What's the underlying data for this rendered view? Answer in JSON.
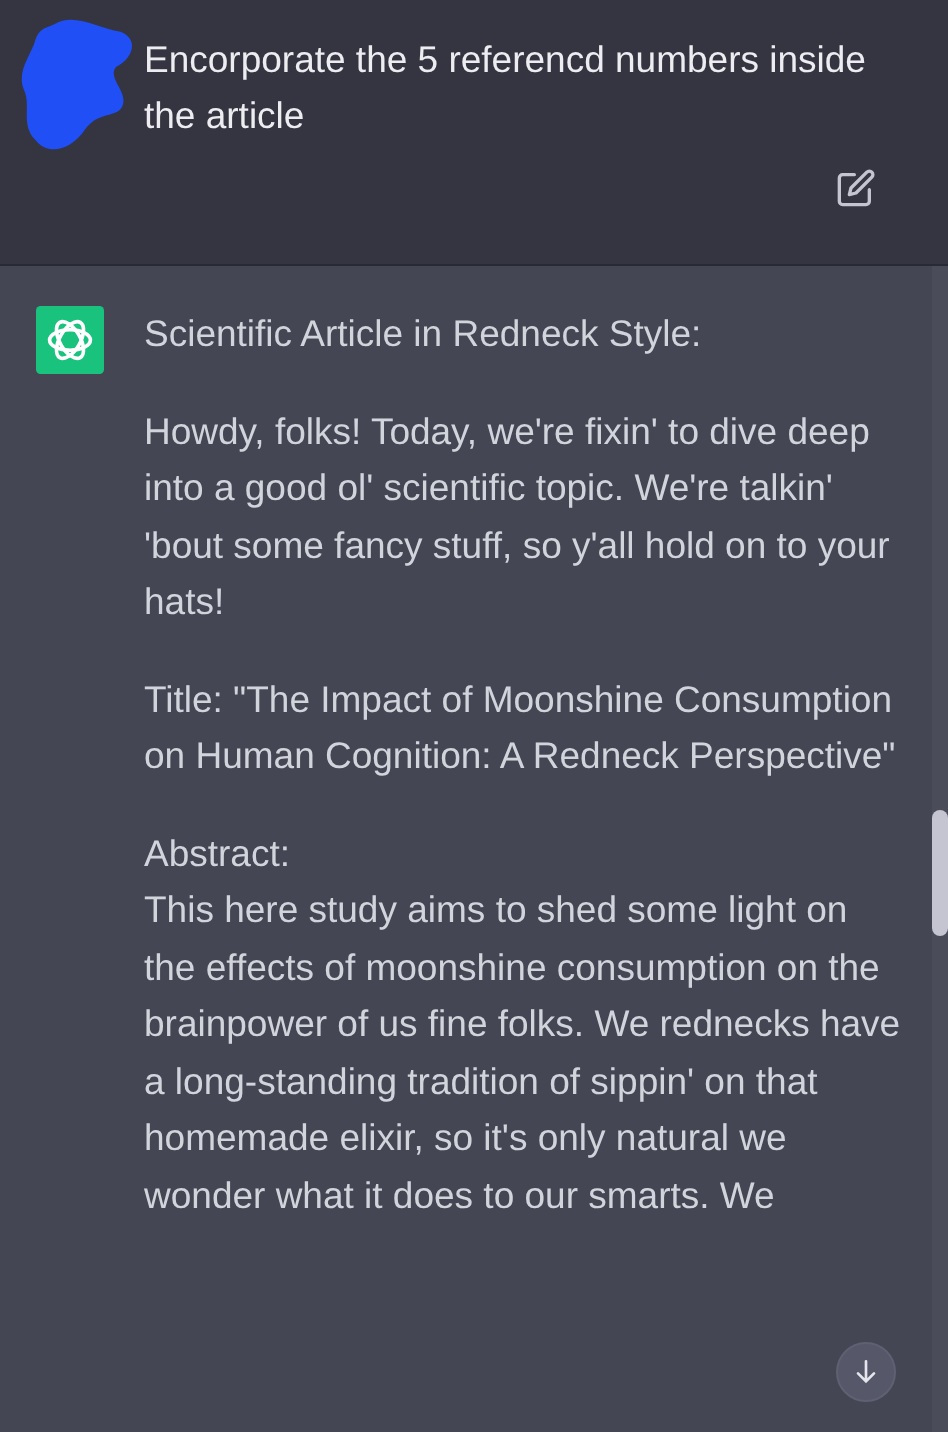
{
  "user_message": {
    "text": "Encorporate the 5 referencd numbers inside the article"
  },
  "assistant_message": {
    "blocks": [
      {
        "kind": "paragraph",
        "text": "Scientific Article in Redneck Style:"
      },
      {
        "kind": "paragraph",
        "text": "Howdy, folks! Today, we're fixin' to dive deep into a good ol' scientific topic. We're talkin' 'bout some fancy stuff, so y'all hold on to your hats!"
      },
      {
        "kind": "paragraph",
        "text": "Title: \"The Impact of Moonshine Consumption on Human Cognition: A Redneck Perspective\""
      },
      {
        "kind": "heading",
        "text": "Abstract:"
      },
      {
        "kind": "paragraph",
        "text": "This here study aims to shed some light on the effects of moonshine consumption on the brainpower of us fine folks. We rednecks have a long-standing tradition of sippin' on that homemade elixir, so it's only natural we wonder what it does to our smarts. We"
      }
    ]
  }
}
